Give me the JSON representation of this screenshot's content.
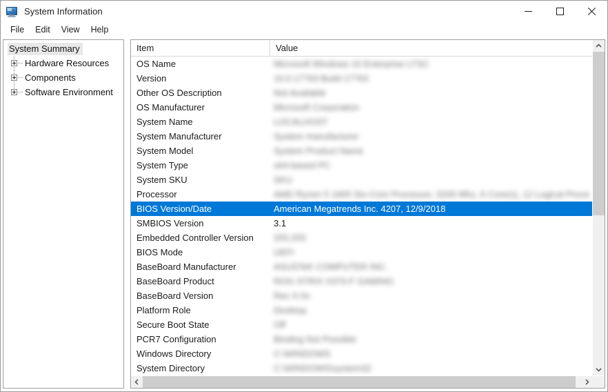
{
  "window": {
    "title": "System Information",
    "icon": "computer-monitor-icon",
    "controls": {
      "minimize": "minimize-icon",
      "maximize": "maximize-icon",
      "close": "close-icon"
    }
  },
  "menubar": {
    "items": [
      {
        "label": "File"
      },
      {
        "label": "Edit"
      },
      {
        "label": "View"
      },
      {
        "label": "Help"
      }
    ]
  },
  "tree": {
    "root": {
      "label": "System Summary",
      "selected": true
    },
    "children": [
      {
        "label": "Hardware Resources",
        "expander": "plus-icon"
      },
      {
        "label": "Components",
        "expander": "plus-icon"
      },
      {
        "label": "Software Environment",
        "expander": "plus-icon"
      }
    ]
  },
  "list": {
    "columns": [
      {
        "label": "Item"
      },
      {
        "label": "Value"
      }
    ],
    "rows": [
      {
        "item": "OS Name",
        "value": "Microsoft Windows 10 Enterprise LTSC",
        "redacted": true,
        "selected": false
      },
      {
        "item": "Version",
        "value": "10.0.17763 Build 17763",
        "redacted": true,
        "selected": false
      },
      {
        "item": "Other OS Description",
        "value": "Not Available",
        "redacted": true,
        "selected": false
      },
      {
        "item": "OS Manufacturer",
        "value": "Microsoft Corporation",
        "redacted": true,
        "selected": false
      },
      {
        "item": "System Name",
        "value": "LOCALHOST",
        "redacted": true,
        "selected": false
      },
      {
        "item": "System Manufacturer",
        "value": "System manufacturer",
        "redacted": true,
        "selected": false
      },
      {
        "item": "System Model",
        "value": "System Product Name",
        "redacted": true,
        "selected": false
      },
      {
        "item": "System Type",
        "value": "x64-based PC",
        "redacted": true,
        "selected": false
      },
      {
        "item": "System SKU",
        "value": "SKU",
        "redacted": true,
        "selected": false
      },
      {
        "item": "Processor",
        "value": "AMD Ryzen 5 1600 Six-Core Processor, 3200 Mhz, 6 Core(s), 12 Logical Proce",
        "redacted": true,
        "selected": false
      },
      {
        "item": "BIOS Version/Date",
        "value": "American Megatrends Inc. 4207, 12/9/2018",
        "redacted": false,
        "selected": true
      },
      {
        "item": "SMBIOS Version",
        "value": "3.1",
        "redacted": false,
        "selected": false
      },
      {
        "item": "Embedded Controller Version",
        "value": "255.255",
        "redacted": true,
        "selected": false
      },
      {
        "item": "BIOS Mode",
        "value": "UEFI",
        "redacted": true,
        "selected": false
      },
      {
        "item": "BaseBoard Manufacturer",
        "value": "ASUSTeK COMPUTER INC.",
        "redacted": true,
        "selected": false
      },
      {
        "item": "BaseBoard Product",
        "value": "ROG STRIX X370-F GAMING",
        "redacted": true,
        "selected": false
      },
      {
        "item": "BaseBoard Version",
        "value": "Rev X.0x",
        "redacted": true,
        "selected": false
      },
      {
        "item": "Platform Role",
        "value": "Desktop",
        "redacted": true,
        "selected": false
      },
      {
        "item": "Secure Boot State",
        "value": "Off",
        "redacted": true,
        "selected": false
      },
      {
        "item": "PCR7 Configuration",
        "value": "Binding Not Possible",
        "redacted": true,
        "selected": false
      },
      {
        "item": "Windows Directory",
        "value": "C:\\WINDOWS",
        "redacted": true,
        "selected": false
      },
      {
        "item": "System Directory",
        "value": "C:\\WINDOWS\\system32",
        "redacted": true,
        "selected": false
      }
    ]
  },
  "scrollbars": {
    "vertical": {
      "up": "chevron-up-icon",
      "down": "chevron-down-icon"
    },
    "horizontal": {
      "left": "chevron-left-icon",
      "right": "chevron-right-icon"
    }
  },
  "colors": {
    "selection": "#0078d7",
    "window_bg": "#ffffff",
    "scrollbar_thumb": "#cdcdcd"
  }
}
